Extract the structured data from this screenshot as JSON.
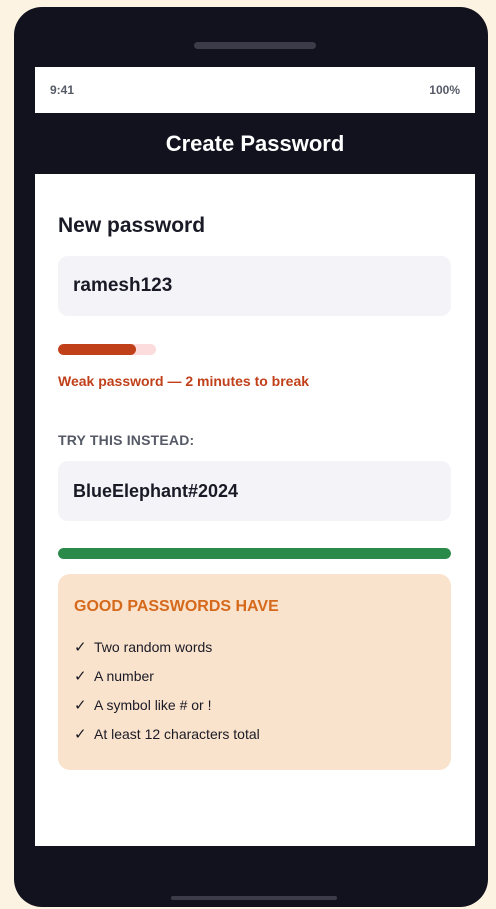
{
  "status_bar": {
    "time": "9:41",
    "battery": "100%"
  },
  "header": {
    "title": "Create Password"
  },
  "form": {
    "new_password_label": "New password",
    "current_value": "ramesh123",
    "strength_fraction": 0.8,
    "strength_message": "Weak password — 2 minutes to break",
    "suggestion_label": "TRY THIS INSTEAD:",
    "suggested_value": "BlueElephant#2024",
    "suggested_strength_fraction": 1.0
  },
  "tips": {
    "title": "GOOD PASSWORDS HAVE",
    "check_icon": "✓",
    "items": [
      "Two random words",
      "A number",
      "A symbol like # or !",
      "At least 12 characters total"
    ]
  },
  "colors": {
    "weak": "#c0401a",
    "strong": "#2a8a4a",
    "tips_accent": "#d5691c"
  }
}
